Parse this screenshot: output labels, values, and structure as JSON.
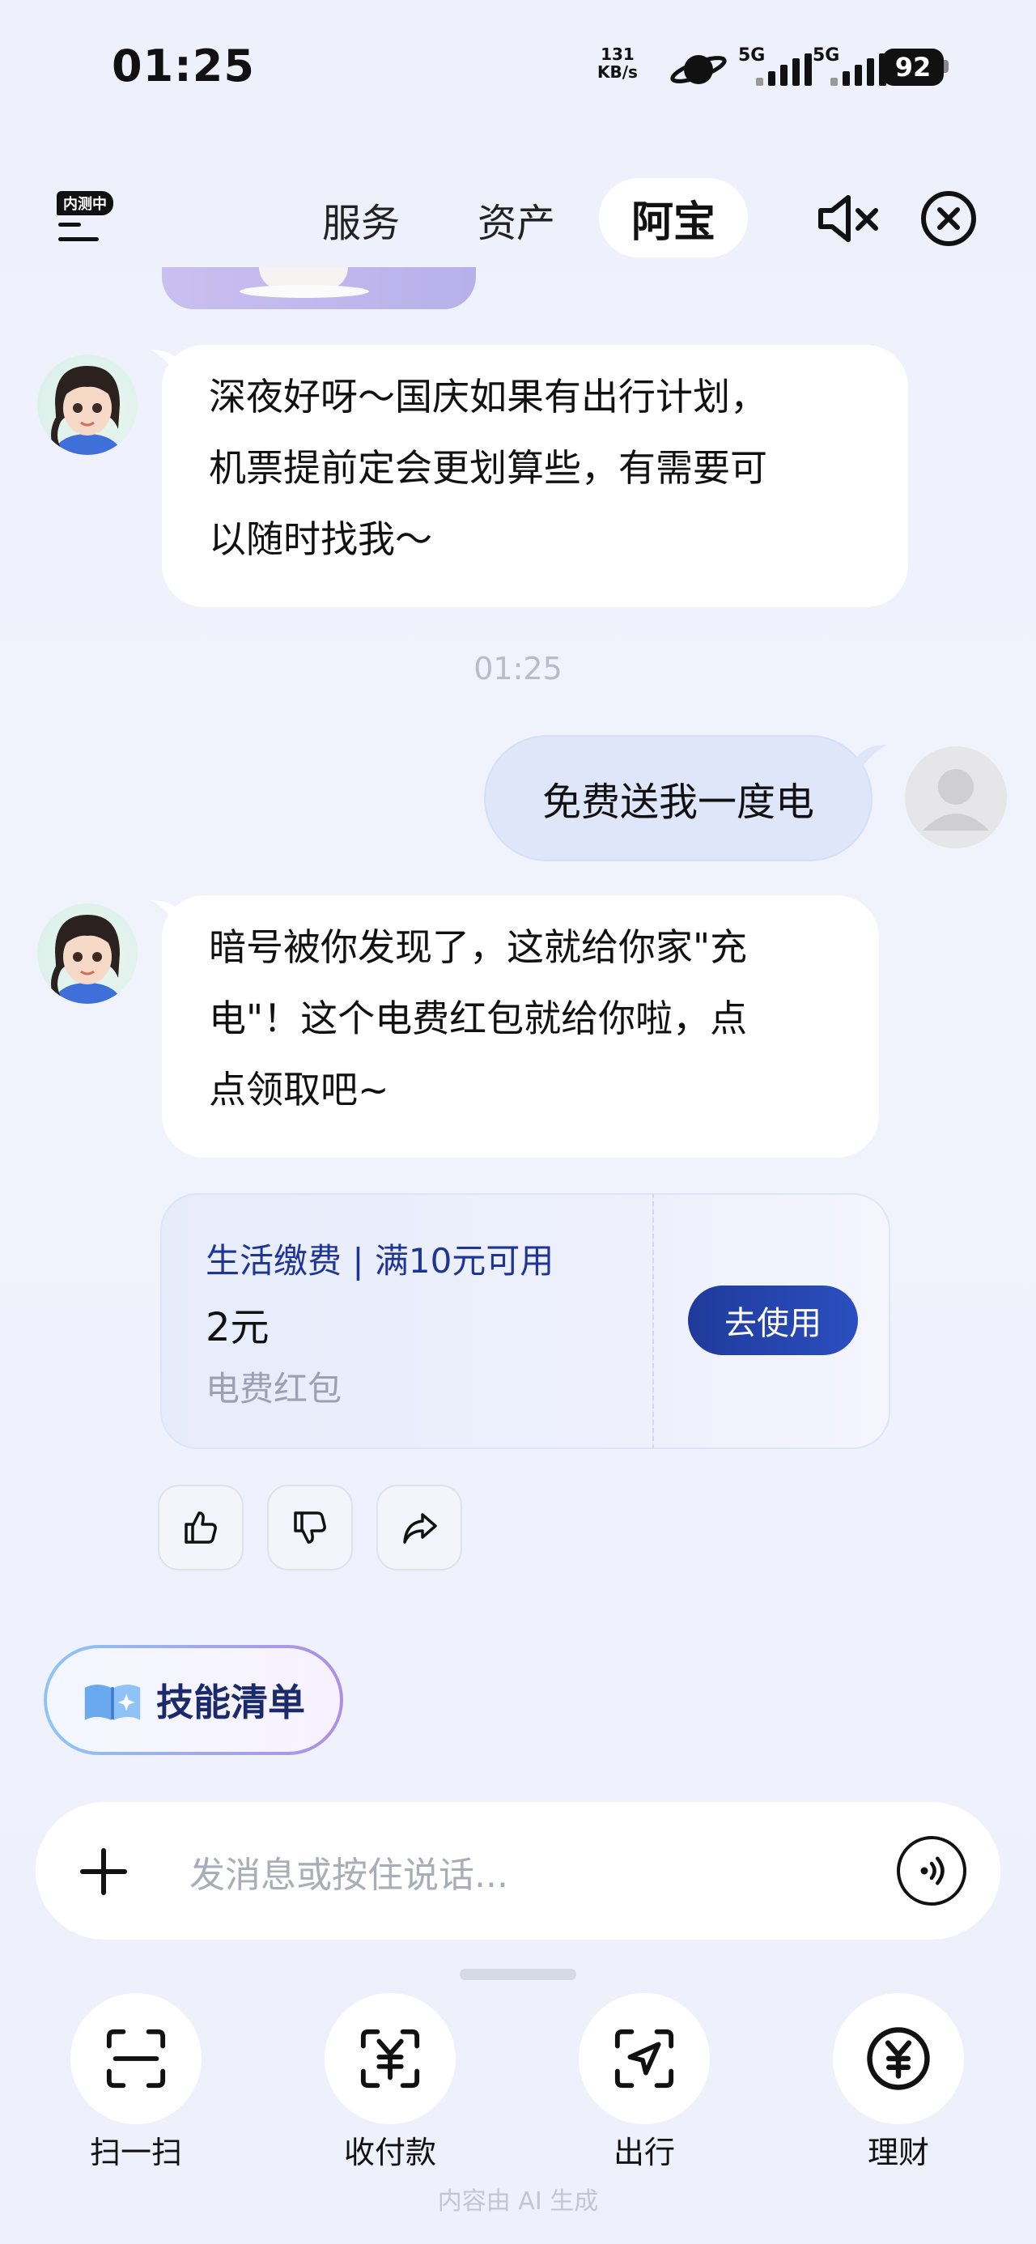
{
  "status_bar": {
    "time": "01:25",
    "net_speed_value": "131",
    "net_speed_unit": "KB/s",
    "signal1_label": "5G",
    "signal2_label": "5G",
    "battery": "92"
  },
  "nav": {
    "beta_badge": "内测中",
    "tabs": [
      {
        "label": "服务"
      },
      {
        "label": "资产"
      },
      {
        "label": "阿宝"
      }
    ],
    "active_tab": "阿宝"
  },
  "messages": [
    {
      "from": "assistant",
      "text_lines": [
        "深夜好呀～国庆如果有出行计划，",
        "机票提前定会更划算些，有需要可",
        "以随时找我～"
      ]
    },
    {
      "type": "time",
      "text": "01:25"
    },
    {
      "from": "user",
      "text": "免费送我一度电"
    },
    {
      "from": "assistant",
      "text_lines": [
        "暗号被你发现了，这就给你家\"充",
        "电\"！这个电费红包就给你啦，点",
        "点领取吧~"
      ]
    }
  ],
  "coupon": {
    "condition": "生活缴费 | 满10元可用",
    "amount": "2元",
    "name": "电费红包",
    "button": "去使用"
  },
  "skills": {
    "label": "技能清单"
  },
  "input": {
    "placeholder": "发消息或按住说话..."
  },
  "actions": [
    {
      "label": "扫一扫",
      "icon": "scan-icon"
    },
    {
      "label": "收付款",
      "icon": "payment-icon"
    },
    {
      "label": "出行",
      "icon": "travel-icon"
    },
    {
      "label": "理财",
      "icon": "finance-icon"
    }
  ],
  "footer_note": "内容由 AI 生成"
}
